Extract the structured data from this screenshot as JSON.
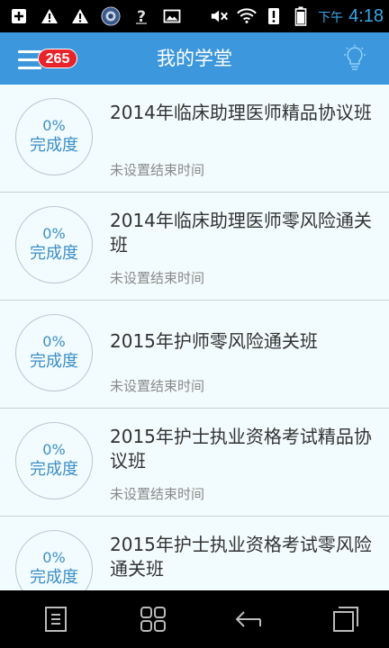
{
  "status_bar": {
    "ampm": "下午",
    "time": "4:18",
    "icons": [
      "add-notification-icon",
      "warning-icon",
      "warning-icon",
      "app-badge-icon",
      "unknown-app-icon",
      "image-icon",
      "mute-icon",
      "wifi-icon",
      "sim-alert-icon",
      "battery-icon"
    ]
  },
  "app_bar": {
    "title": "我的学堂",
    "badge_count": "265",
    "menu_icon": "menu-icon",
    "right_icon": "lightbulb-icon"
  },
  "courses": [
    {
      "progress": "0%",
      "progress_label": "完成度",
      "title": "2014年临床助理医师精品协议班",
      "end_time": "未设置结束时间"
    },
    {
      "progress": "0%",
      "progress_label": "完成度",
      "title": "2014年临床助理医师零风险通关班",
      "end_time": "未设置结束时间"
    },
    {
      "progress": "0%",
      "progress_label": "完成度",
      "title": "2015年护师零风险通关班",
      "end_time": "未设置结束时间"
    },
    {
      "progress": "0%",
      "progress_label": "完成度",
      "title": "2015年护士执业资格考试精品协议班",
      "end_time": "未设置结束时间"
    },
    {
      "progress": "0%",
      "progress_label": "完成度",
      "title": "2015年护士执业资格考试零风险通关班",
      "end_time": ""
    }
  ],
  "nav_bar": {
    "icons": [
      "menu-icon",
      "home-grid-icon",
      "back-icon",
      "recent-apps-icon"
    ]
  }
}
